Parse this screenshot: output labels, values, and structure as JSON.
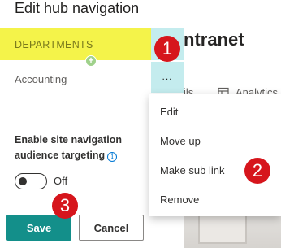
{
  "panel": {
    "title": "Edit hub navigation",
    "nav_items": [
      {
        "label": "DEPARTMENTS",
        "highlight_color": "#f4f34a"
      },
      {
        "label": "Accounting"
      }
    ],
    "add_link_symbol": "+",
    "ellipsis_label": "...",
    "audience_targeting": {
      "label": "Enable site navigation audience targeting",
      "info_symbol": "i",
      "toggle_state": "Off",
      "toggle_on": false
    },
    "save_label": "Save",
    "cancel_label": "Cancel"
  },
  "context_menu": {
    "items": [
      {
        "label": "Edit"
      },
      {
        "label": "Move up"
      },
      {
        "label": "Make sub link"
      },
      {
        "label": "Remove"
      }
    ]
  },
  "background_site": {
    "title_fragment": "ntranet",
    "nav_fragment": "ils",
    "nav_analytics": "Analytics",
    "analytics_icon": "analytics-icon"
  },
  "step_callouts": [
    "1",
    "2",
    "3"
  ],
  "colors": {
    "accent_teal": "#138f8a",
    "menu_button_bg": "#c4ecee",
    "callout_red": "#d6151c",
    "highlight_yellow": "#f4f34a"
  }
}
